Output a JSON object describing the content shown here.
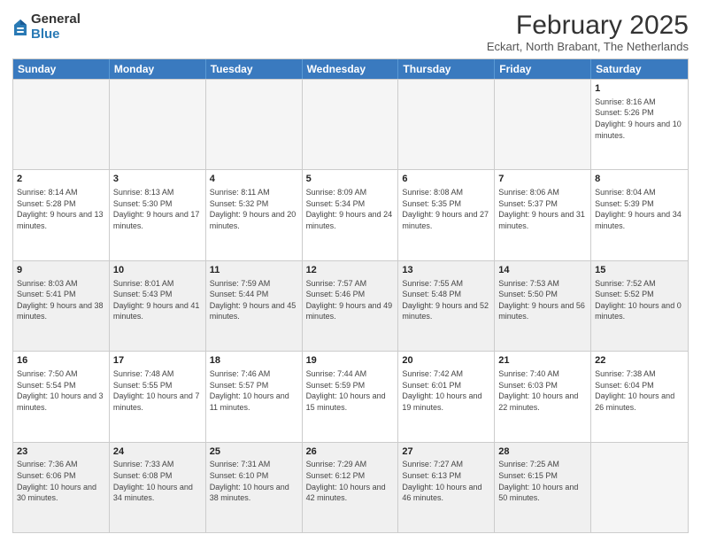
{
  "logo": {
    "general": "General",
    "blue": "Blue"
  },
  "title": "February 2025",
  "subtitle": "Eckart, North Brabant, The Netherlands",
  "header_days": [
    "Sunday",
    "Monday",
    "Tuesday",
    "Wednesday",
    "Thursday",
    "Friday",
    "Saturday"
  ],
  "weeks": [
    {
      "cells": [
        {
          "day": "",
          "info": "",
          "empty": true
        },
        {
          "day": "",
          "info": "",
          "empty": true
        },
        {
          "day": "",
          "info": "",
          "empty": true
        },
        {
          "day": "",
          "info": "",
          "empty": true
        },
        {
          "day": "",
          "info": "",
          "empty": true
        },
        {
          "day": "",
          "info": "",
          "empty": true
        },
        {
          "day": "1",
          "info": "Sunrise: 8:16 AM\nSunset: 5:26 PM\nDaylight: 9 hours and 10 minutes.",
          "empty": false
        }
      ]
    },
    {
      "cells": [
        {
          "day": "2",
          "info": "Sunrise: 8:14 AM\nSunset: 5:28 PM\nDaylight: 9 hours and 13 minutes.",
          "empty": false
        },
        {
          "day": "3",
          "info": "Sunrise: 8:13 AM\nSunset: 5:30 PM\nDaylight: 9 hours and 17 minutes.",
          "empty": false
        },
        {
          "day": "4",
          "info": "Sunrise: 8:11 AM\nSunset: 5:32 PM\nDaylight: 9 hours and 20 minutes.",
          "empty": false
        },
        {
          "day": "5",
          "info": "Sunrise: 8:09 AM\nSunset: 5:34 PM\nDaylight: 9 hours and 24 minutes.",
          "empty": false
        },
        {
          "day": "6",
          "info": "Sunrise: 8:08 AM\nSunset: 5:35 PM\nDaylight: 9 hours and 27 minutes.",
          "empty": false
        },
        {
          "day": "7",
          "info": "Sunrise: 8:06 AM\nSunset: 5:37 PM\nDaylight: 9 hours and 31 minutes.",
          "empty": false
        },
        {
          "day": "8",
          "info": "Sunrise: 8:04 AM\nSunset: 5:39 PM\nDaylight: 9 hours and 34 minutes.",
          "empty": false
        }
      ]
    },
    {
      "cells": [
        {
          "day": "9",
          "info": "Sunrise: 8:03 AM\nSunset: 5:41 PM\nDaylight: 9 hours and 38 minutes.",
          "empty": false
        },
        {
          "day": "10",
          "info": "Sunrise: 8:01 AM\nSunset: 5:43 PM\nDaylight: 9 hours and 41 minutes.",
          "empty": false
        },
        {
          "day": "11",
          "info": "Sunrise: 7:59 AM\nSunset: 5:44 PM\nDaylight: 9 hours and 45 minutes.",
          "empty": false
        },
        {
          "day": "12",
          "info": "Sunrise: 7:57 AM\nSunset: 5:46 PM\nDaylight: 9 hours and 49 minutes.",
          "empty": false
        },
        {
          "day": "13",
          "info": "Sunrise: 7:55 AM\nSunset: 5:48 PM\nDaylight: 9 hours and 52 minutes.",
          "empty": false
        },
        {
          "day": "14",
          "info": "Sunrise: 7:53 AM\nSunset: 5:50 PM\nDaylight: 9 hours and 56 minutes.",
          "empty": false
        },
        {
          "day": "15",
          "info": "Sunrise: 7:52 AM\nSunset: 5:52 PM\nDaylight: 10 hours and 0 minutes.",
          "empty": false
        }
      ]
    },
    {
      "cells": [
        {
          "day": "16",
          "info": "Sunrise: 7:50 AM\nSunset: 5:54 PM\nDaylight: 10 hours and 3 minutes.",
          "empty": false
        },
        {
          "day": "17",
          "info": "Sunrise: 7:48 AM\nSunset: 5:55 PM\nDaylight: 10 hours and 7 minutes.",
          "empty": false
        },
        {
          "day": "18",
          "info": "Sunrise: 7:46 AM\nSunset: 5:57 PM\nDaylight: 10 hours and 11 minutes.",
          "empty": false
        },
        {
          "day": "19",
          "info": "Sunrise: 7:44 AM\nSunset: 5:59 PM\nDaylight: 10 hours and 15 minutes.",
          "empty": false
        },
        {
          "day": "20",
          "info": "Sunrise: 7:42 AM\nSunset: 6:01 PM\nDaylight: 10 hours and 19 minutes.",
          "empty": false
        },
        {
          "day": "21",
          "info": "Sunrise: 7:40 AM\nSunset: 6:03 PM\nDaylight: 10 hours and 22 minutes.",
          "empty": false
        },
        {
          "day": "22",
          "info": "Sunrise: 7:38 AM\nSunset: 6:04 PM\nDaylight: 10 hours and 26 minutes.",
          "empty": false
        }
      ]
    },
    {
      "cells": [
        {
          "day": "23",
          "info": "Sunrise: 7:36 AM\nSunset: 6:06 PM\nDaylight: 10 hours and 30 minutes.",
          "empty": false
        },
        {
          "day": "24",
          "info": "Sunrise: 7:33 AM\nSunset: 6:08 PM\nDaylight: 10 hours and 34 minutes.",
          "empty": false
        },
        {
          "day": "25",
          "info": "Sunrise: 7:31 AM\nSunset: 6:10 PM\nDaylight: 10 hours and 38 minutes.",
          "empty": false
        },
        {
          "day": "26",
          "info": "Sunrise: 7:29 AM\nSunset: 6:12 PM\nDaylight: 10 hours and 42 minutes.",
          "empty": false
        },
        {
          "day": "27",
          "info": "Sunrise: 7:27 AM\nSunset: 6:13 PM\nDaylight: 10 hours and 46 minutes.",
          "empty": false
        },
        {
          "day": "28",
          "info": "Sunrise: 7:25 AM\nSunset: 6:15 PM\nDaylight: 10 hours and 50 minutes.",
          "empty": false
        },
        {
          "day": "",
          "info": "",
          "empty": true
        }
      ]
    }
  ]
}
